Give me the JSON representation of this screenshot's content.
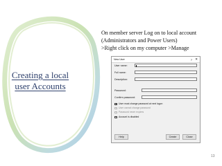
{
  "slide": {
    "title_lines": [
      "Creating a local",
      "user Accounts"
    ],
    "instructions": [
      "On member server Log on to local account",
      "(Administrators and Power Users)",
      ">Right click on my computer >Manage"
    ],
    "page_number": "13"
  },
  "dialog": {
    "title": "New User",
    "help_glyph": "?",
    "close_glyph": "✕",
    "fields": {
      "user_name": {
        "label": "User name:",
        "value": ""
      },
      "full_name": {
        "label": "Full name:",
        "value": ""
      },
      "description": {
        "label": "Description:",
        "value": ""
      },
      "password": {
        "label": "Password:",
        "value": ""
      },
      "confirm_password": {
        "label": "Confirm password:",
        "value": ""
      }
    },
    "options": [
      {
        "label": "User must change password at next logon",
        "checked": true,
        "enabled": true
      },
      {
        "label": "User cannot change password",
        "checked": false,
        "enabled": false
      },
      {
        "label": "Password never expires",
        "checked": false,
        "enabled": false
      },
      {
        "label": "Account is disabled",
        "checked": false,
        "enabled": true
      }
    ],
    "buttons": {
      "help": "Help",
      "create": "Create",
      "close": "Close"
    }
  },
  "colors": {
    "title_text": "#2d3f6b",
    "ring_green": "#b9d89a",
    "ring_blue": "#9cc4de",
    "dialog_bg": "#f0f0f0"
  }
}
